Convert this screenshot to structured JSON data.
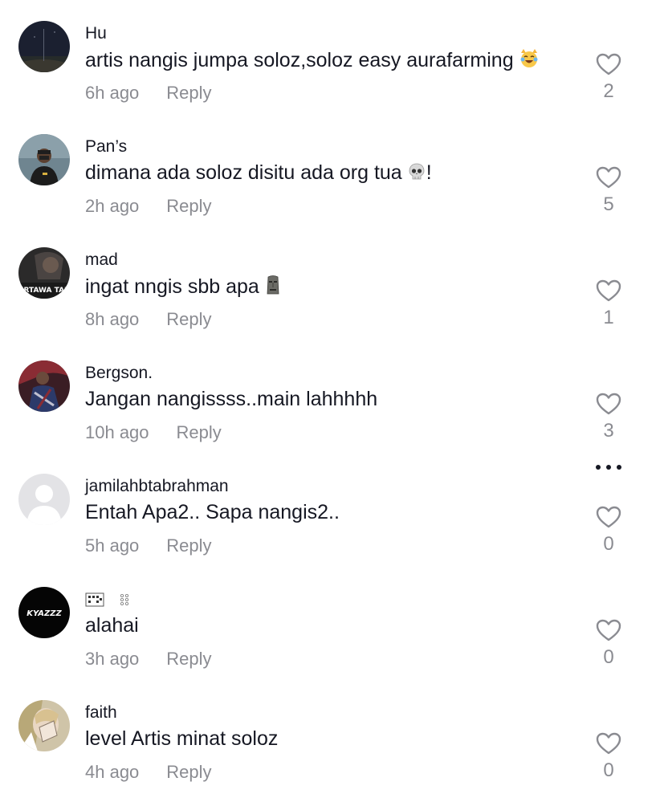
{
  "comments": [
    {
      "username": "Hu",
      "text": "artis nangis jumpa soloz,soloz easy aurafarming",
      "emoji": "crying-laughing-cat-icon",
      "time": "6h ago",
      "reply": "Reply",
      "likes": "2"
    },
    {
      "username": "Pan’s",
      "text": "dimana ada soloz disitu ada org tua",
      "emoji": "skull-icon",
      "suffix": "!",
      "time": "2h ago",
      "reply": "Reply",
      "likes": "5"
    },
    {
      "username": "mad",
      "text": "ingat nngis sbb apa",
      "emoji": "moai-icon",
      "avatar_text": "ERTAWA TAP",
      "time": "8h ago",
      "reply": "Reply",
      "likes": "1"
    },
    {
      "username": "Bergson.",
      "text": "Jangan nangissss..main lahhhhh",
      "time": "10h ago",
      "reply": "Reply",
      "likes": "3"
    },
    {
      "username": "jamilahbtabrahman",
      "text": "Entah Apa2.. Sapa nangis2..",
      "time": "5h ago",
      "reply": "Reply",
      "likes": "0"
    },
    {
      "username_icons": [
        "braille-glyph-icon",
        "braille-dots-icon"
      ],
      "text": "alahai",
      "avatar_text": "KYAZZZ",
      "time": "3h ago",
      "reply": "Reply",
      "likes": "0"
    },
    {
      "username": "faith",
      "text": "level Artis minat soloz",
      "time": "4h ago",
      "reply": "Reply",
      "likes": "0"
    }
  ],
  "colors": {
    "text_primary": "#161823",
    "text_secondary": "#8a8b91",
    "icon": "#8a8b91"
  }
}
